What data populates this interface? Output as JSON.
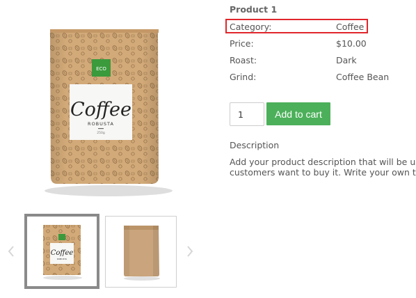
{
  "product": {
    "title": "Product 1",
    "attributes": [
      {
        "label": "Category:",
        "value": "Coffee"
      },
      {
        "label": "Price:",
        "value": "$10.00"
      },
      {
        "label": "Roast:",
        "value": "Dark"
      },
      {
        "label": "Grind:",
        "value": "Coffee Bean"
      }
    ],
    "highlighted_attribute": "Category:",
    "highlight_color": "#e0262b"
  },
  "cart": {
    "quantity": "1",
    "add_to_cart_label": "Add to cart",
    "button_color": "#4cb05a"
  },
  "description": {
    "heading": "Description",
    "lines": [
      "Add your product description that will be usef",
      "customers want to buy it. Write your own text"
    ]
  },
  "packaging": {
    "eco_label": "ECO",
    "brand": "Coffee",
    "variety": "ROBUSTA",
    "weight": "250g",
    "bag_color": "#d2a978",
    "eco_color": "#3a9a3c"
  },
  "gallery": {
    "thumbnails": [
      {
        "name": "printed coffee bag",
        "selected": true
      },
      {
        "name": "plain kraft bag",
        "selected": false
      }
    ],
    "prev_icon": "chevron-left-icon",
    "next_icon": "chevron-right-icon"
  }
}
